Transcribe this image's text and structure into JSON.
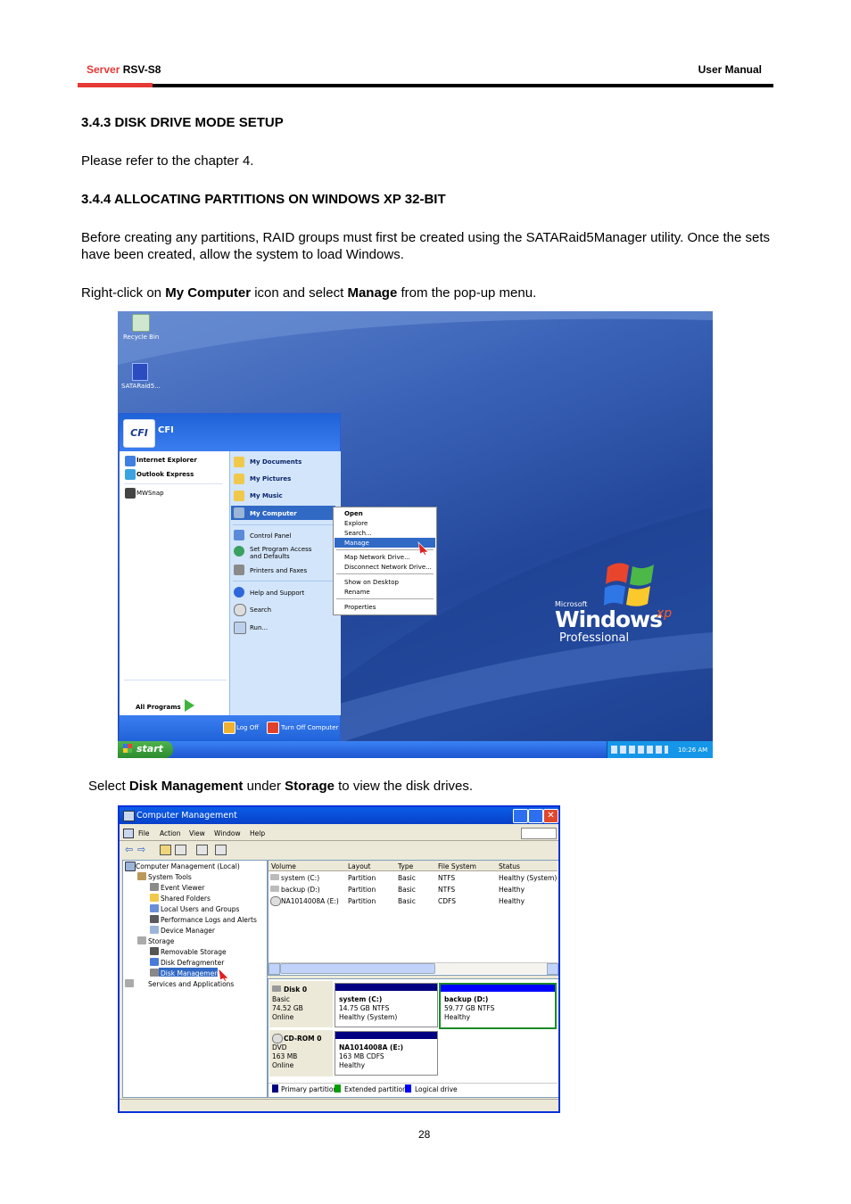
{
  "header": {
    "brand_red": "Server",
    "brand_black": "RSV-S8",
    "right": "User Manual"
  },
  "sections": {
    "s1_title": "3.4.3 DISK DRIVE MODE SETUP",
    "s1_text": "Please refer to the chapter 4.",
    "s2_title": "3.4.4 ALLOCATING PARTITIONS ON WINDOWS XP 32-BIT",
    "s2_text": "Before creating any partitions, RAID groups must first be created using the SATARaid5Manager utility. Once the sets have been created, allow the system to load Windows.",
    "p3_pre": "Right-click on ",
    "p3_b1": "My Computer",
    "p3_mid": " icon and select ",
    "p3_b2": "Manage",
    "p3_post": " from the pop-up menu.",
    "p4_pre": "Select ",
    "p4_b1": "Disk Management",
    "p4_mid": " under ",
    "p4_b2": "Storage",
    "p4_post": " to view the disk drives."
  },
  "desktop": {
    "icons": [
      "Recycle Bin",
      "SATARaid5..."
    ],
    "user": "CFI",
    "start_left": [
      "Internet Explorer",
      "Outlook Express",
      "MWSnap"
    ],
    "start_right": [
      "My Documents",
      "My Pictures",
      "My Music",
      "My Computer",
      "Control Panel",
      "Set Program Access and Defaults",
      "Printers and Faxes",
      "Help and Support",
      "Search",
      "Run..."
    ],
    "all_programs": "All Programs",
    "logoff": "Log Off",
    "turnoff": "Turn Off Computer",
    "context_menu": [
      "Open",
      "Explore",
      "Search...",
      "Manage",
      "Map Network Drive...",
      "Disconnect Network Drive...",
      "Show on Desktop",
      "Rename",
      "Properties"
    ],
    "logo_ms": "Microsoft",
    "logo_win": "Windows",
    "logo_xp": "xp",
    "logo_pro": "Professional",
    "start_button": "start",
    "clock": "10:26 AM"
  },
  "mgmt": {
    "title": "Computer Management",
    "menu": [
      "File",
      "Action",
      "View",
      "Window",
      "Help"
    ],
    "tree": [
      "Computer Management (Local)",
      "System Tools",
      "Event Viewer",
      "Shared Folders",
      "Local Users and Groups",
      "Performance Logs and Alerts",
      "Device Manager",
      "Storage",
      "Removable Storage",
      "Disk Defragmenter",
      "Disk Management",
      "Services and Applications"
    ],
    "columns": [
      "Volume",
      "Layout",
      "Type",
      "File System",
      "Status"
    ],
    "rows": [
      [
        "system (C:)",
        "Partition",
        "Basic",
        "NTFS",
        "Healthy (System)"
      ],
      [
        "backup (D:)",
        "Partition",
        "Basic",
        "NTFS",
        "Healthy"
      ],
      [
        "NA1014008A (E:)",
        "Partition",
        "Basic",
        "CDFS",
        "Healthy"
      ]
    ],
    "disk0": {
      "name": "Disk 0",
      "type": "Basic",
      "size": "74.52 GB",
      "state": "Online"
    },
    "part_c": {
      "name": "system  (C:)",
      "size": "14.75 GB NTFS",
      "status": "Healthy (System)"
    },
    "part_d": {
      "name": "backup  (D:)",
      "size": "59.77 GB NTFS",
      "status": "Healthy"
    },
    "cdrom": {
      "name": "CD-ROM 0",
      "type": "DVD",
      "size": "163 MB",
      "state": "Online"
    },
    "part_e": {
      "name": "NA1014008A  (E:)",
      "size": "163 MB CDFS",
      "status": "Healthy"
    },
    "legend": [
      "Primary partition",
      "Extended partition",
      "Logical drive"
    ],
    "colors": {
      "primary": "#000080",
      "extended": "#00a000",
      "logical": "#0000ff"
    }
  },
  "page_number": "28",
  "colors": {
    "accent_red": "#d32f2f"
  }
}
